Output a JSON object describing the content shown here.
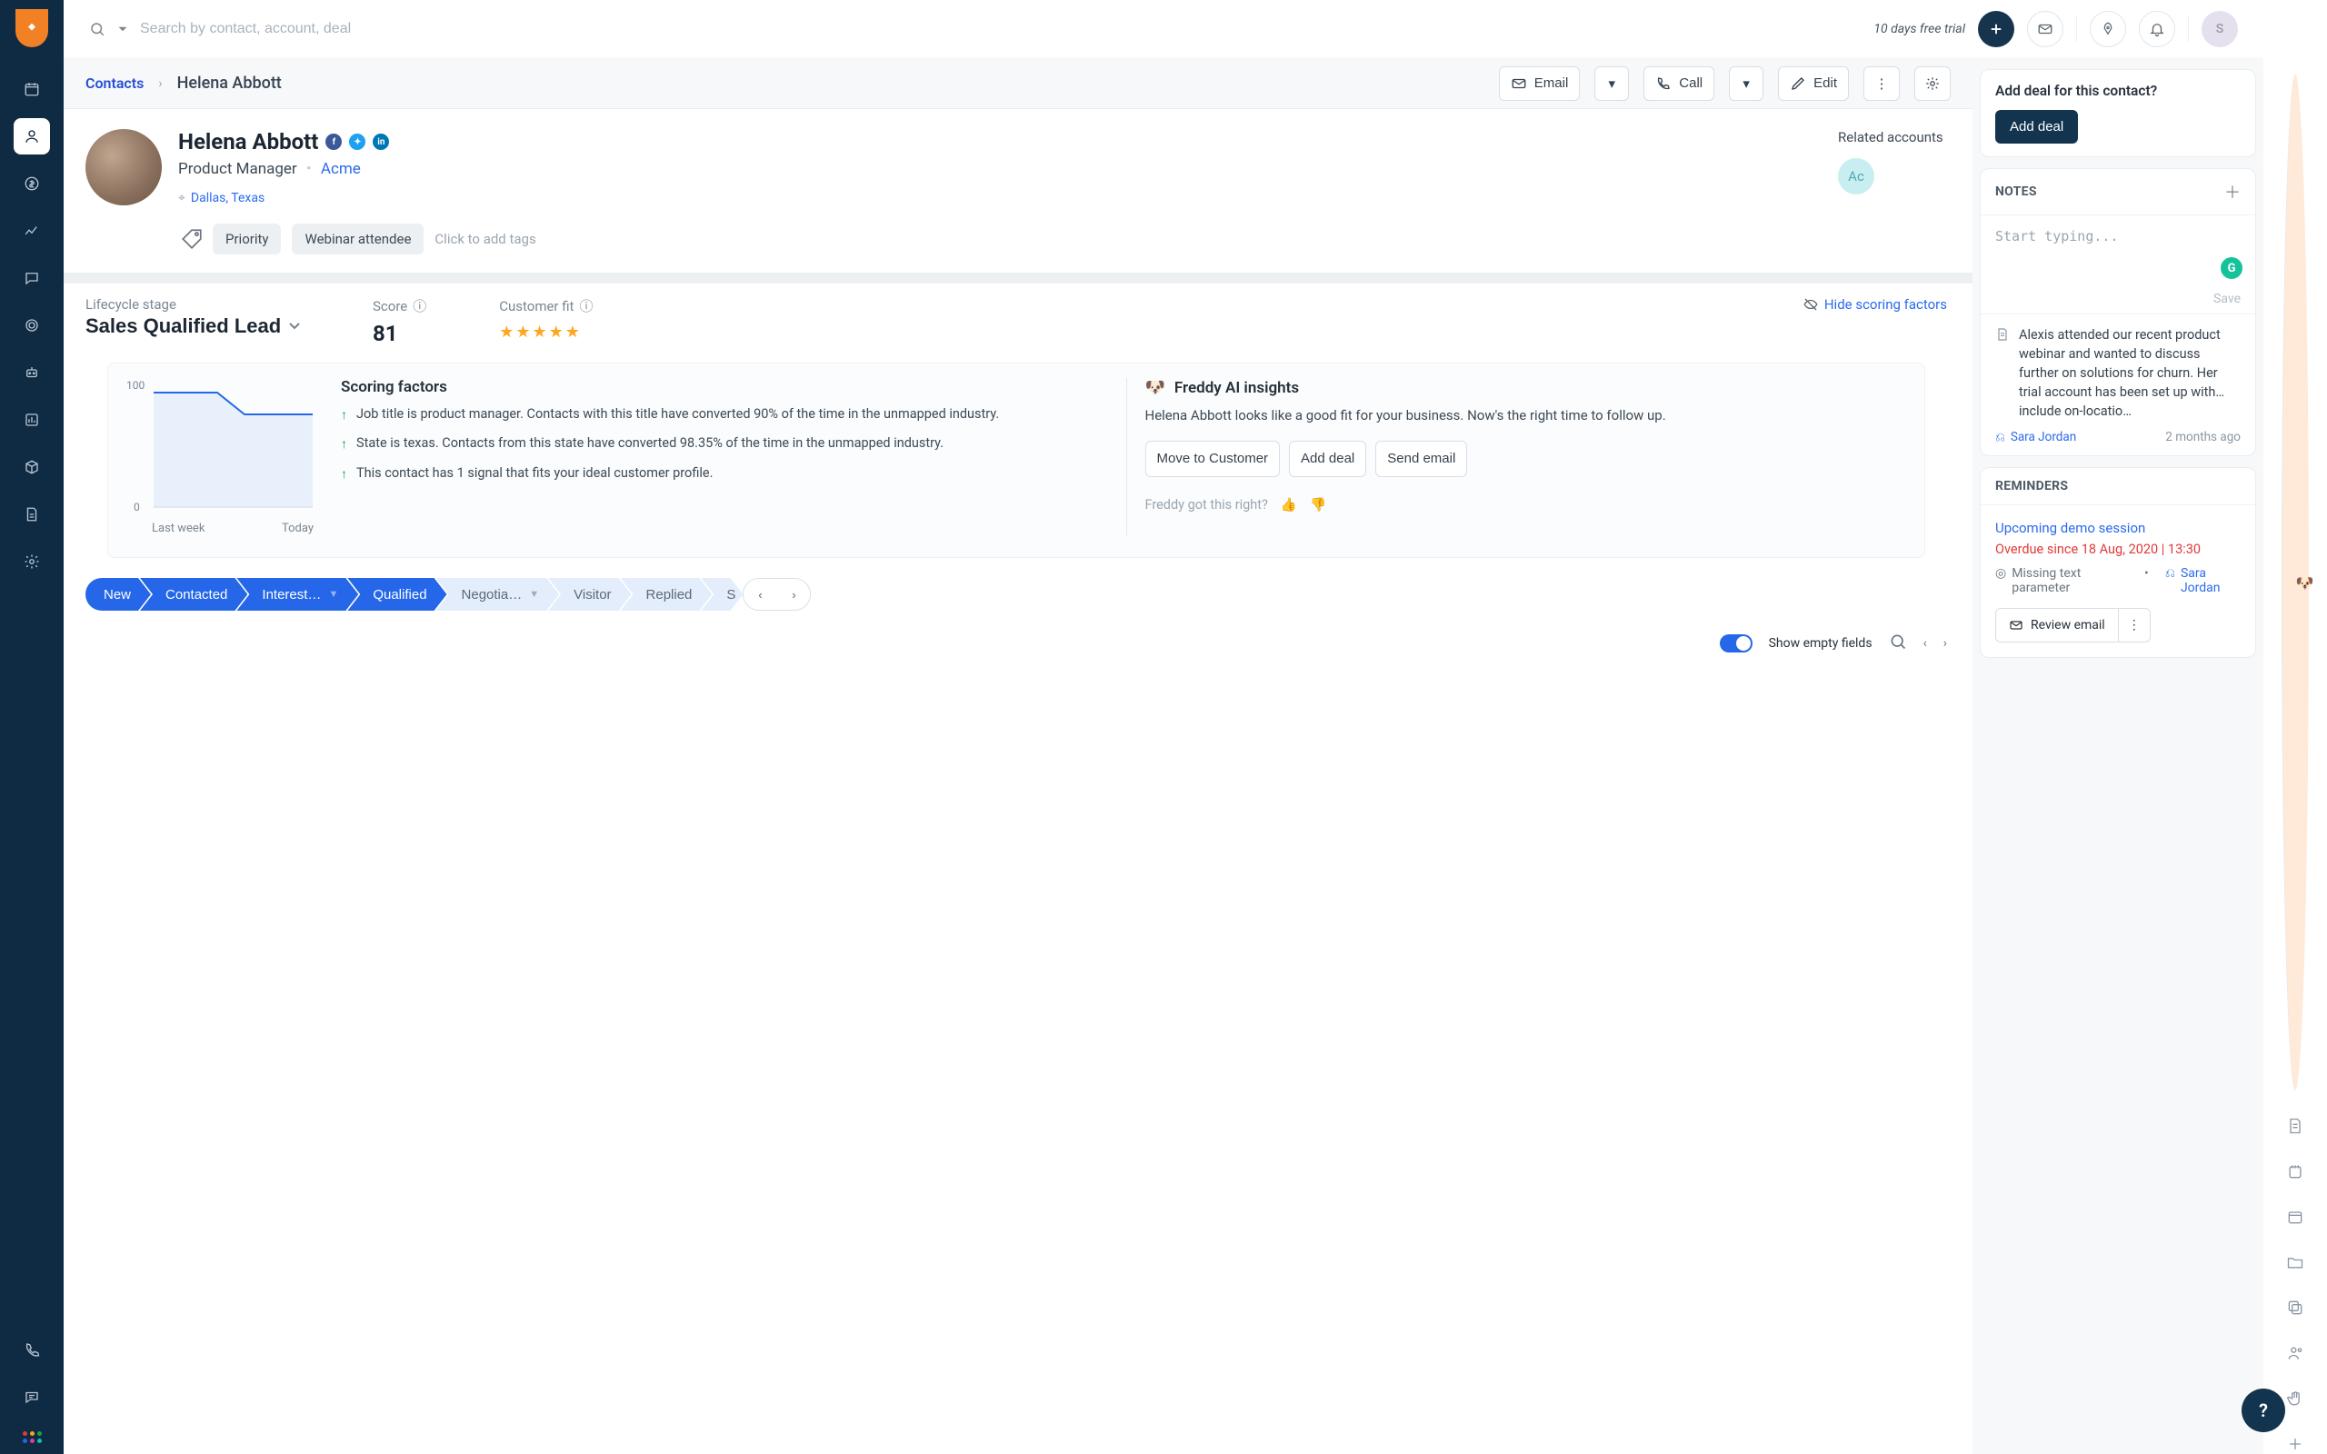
{
  "topbar": {
    "search_placeholder": "Search by contact, account, deal",
    "trial_text": "10 days free trial",
    "avatar_letter": "S"
  },
  "sidebar_rail": {
    "items": [
      "calendar",
      "contacts",
      "deals",
      "analytics",
      "chat",
      "goals",
      "bot",
      "reports",
      "package",
      "doc",
      "settings"
    ],
    "active_index": 1
  },
  "breadcrumb": {
    "root": "Contacts",
    "current": "Helena Abbott",
    "actions": {
      "email": "Email",
      "call": "Call",
      "edit": "Edit"
    }
  },
  "contact": {
    "name": "Helena Abbott",
    "role": "Product Manager",
    "company": "Acme",
    "location": "Dallas, Texas",
    "tags": [
      "Priority",
      "Webinar attendee"
    ],
    "add_tag_placeholder": "Click to add tags",
    "related_accounts_label": "Related accounts",
    "related_account_badge": "Ac"
  },
  "metrics": {
    "lifecycle_label": "Lifecycle stage",
    "lifecycle_value": "Sales Qualified Lead",
    "score_label": "Score",
    "score_value": "81",
    "fit_label": "Customer fit",
    "fit_stars": 5,
    "hide_link": "Hide scoring factors"
  },
  "chart_data": {
    "type": "line",
    "title": "",
    "xlabel": "",
    "ylabel": "",
    "x_ticks": [
      "Last week",
      "Today"
    ],
    "y_ticks": [
      0,
      100
    ],
    "ylim": [
      0,
      100
    ],
    "series": [
      {
        "name": "Score",
        "x": [
          0,
          1,
          2,
          3,
          4,
          5,
          6
        ],
        "values": [
          100,
          100,
          100,
          96,
          82,
          82,
          82
        ]
      }
    ]
  },
  "scoring": {
    "heading": "Scoring factors",
    "factors": [
      "Job title is product manager. Contacts with this title have converted 90% of the time in the unmapped industry.",
      "State is texas. Contacts from this state have converted 98.35% of the time in the unmapped industry.",
      "This contact has 1 signal that fits your ideal customer profile."
    ]
  },
  "freddy": {
    "heading": "Freddy AI insights",
    "pitch": "Helena Abbott looks like a good fit for your business. Now's the right time to follow up.",
    "actions": {
      "move": "Move to Customer",
      "add_deal": "Add deal",
      "send_email": "Send email"
    },
    "feedback_q": "Freddy got this right?"
  },
  "stages": {
    "items": [
      {
        "label": "New",
        "active": true
      },
      {
        "label": "Contacted",
        "active": true
      },
      {
        "label": "Interest…",
        "active": true,
        "has_dd": true
      },
      {
        "label": "Qualified",
        "active": true
      },
      {
        "label": "Negotia…",
        "active": false,
        "has_dd": true
      },
      {
        "label": "Visitor",
        "active": false
      },
      {
        "label": "Replied",
        "active": false
      },
      {
        "label": "S",
        "active": false
      }
    ]
  },
  "footer": {
    "show_empty": "Show empty fields"
  },
  "side_panel": {
    "deal_q": "Add deal for this contact?",
    "deal_btn": "Add deal",
    "notes_heading": "NOTES",
    "notes_placeholder": "Start typing...",
    "notes_save": "Save",
    "note": {
      "text": "Alexis attended our recent product webinar and wanted to discuss further on solutions for churn. Her trial account has been set up with… include on-locatio…",
      "author": "Sara Jordan",
      "age": "2 months ago"
    },
    "reminders_heading": "REMINDERS",
    "reminder": {
      "title": "Upcoming demo session",
      "overdue": "Overdue since 18 Aug, 2020 | 13:30",
      "missing": "Missing text parameter",
      "author": "Sara Jordan",
      "review_label": "Review email"
    }
  },
  "right_rail": {
    "items": [
      "freddy",
      "doc",
      "note",
      "calendar",
      "folder",
      "copy",
      "user",
      "hand",
      "plus"
    ]
  },
  "help_label": "?"
}
